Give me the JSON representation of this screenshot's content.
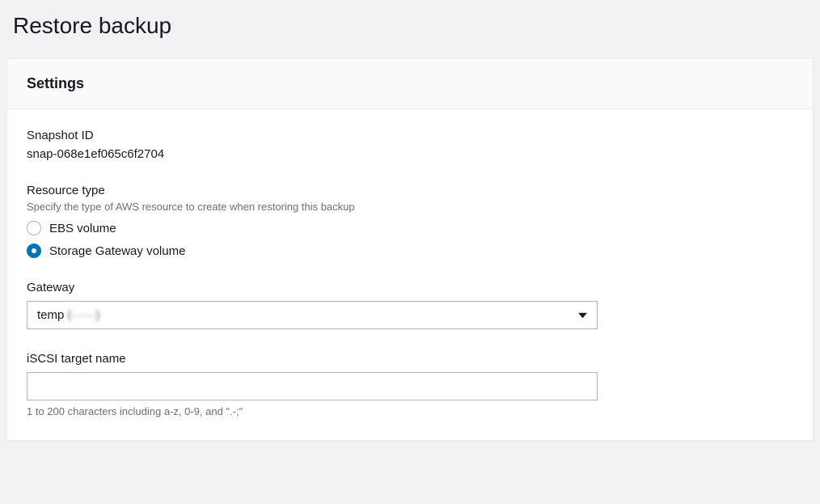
{
  "page": {
    "title": "Restore backup"
  },
  "settings": {
    "heading": "Settings",
    "snapshot": {
      "label": "Snapshot ID",
      "value": "snap-068e1ef065c6f2704"
    },
    "resourceType": {
      "label": "Resource type",
      "description": "Specify the type of AWS resource to create when restoring this backup",
      "options": {
        "ebs": "EBS volume",
        "sgw": "Storage Gateway volume"
      },
      "selected": "sgw"
    },
    "gateway": {
      "label": "Gateway",
      "value": "temp",
      "suffix_obscured": "(······)"
    },
    "iscsi": {
      "label": "iSCSI target name",
      "value": "",
      "hint": "1 to 200 characters including a-z, 0-9, and \".-;\""
    }
  }
}
